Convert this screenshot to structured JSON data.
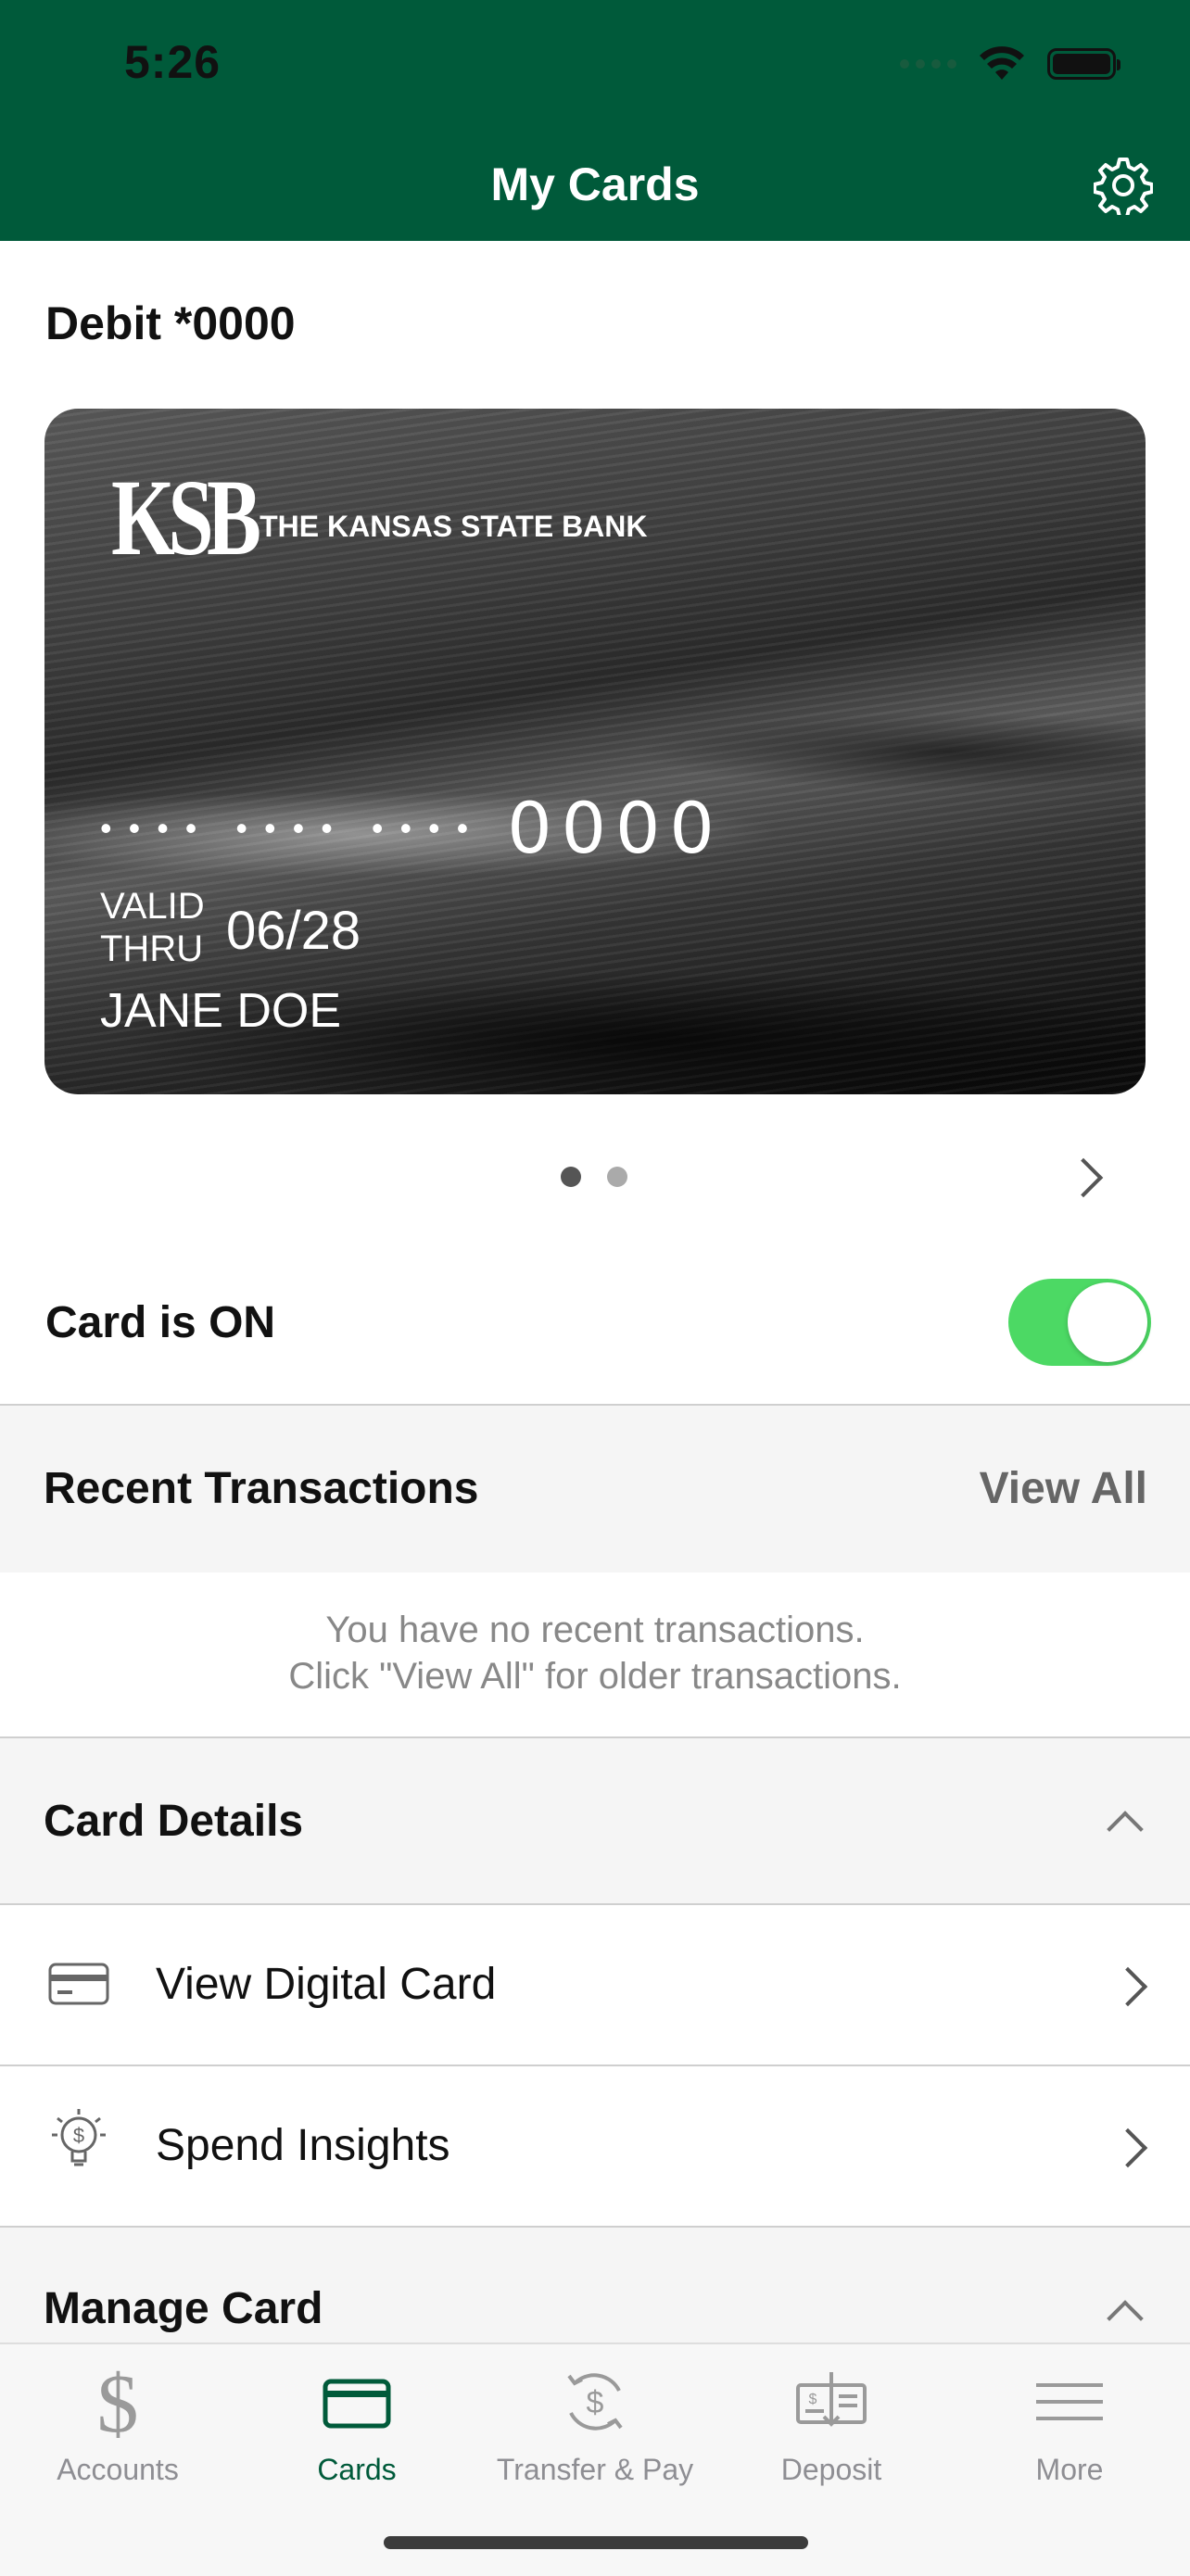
{
  "status_bar": {
    "time": "5:26"
  },
  "header": {
    "title": "My Cards",
    "settings_icon": "gear-icon",
    "background": "#005a3a"
  },
  "card": {
    "title": "Debit *0000",
    "bank_name": "THE KANSAS STATE BANK",
    "logo_mark": "KSB",
    "masked_groups": [
      "••••",
      "••••",
      "••••"
    ],
    "last4": "0000",
    "valid_label_1": "VALID",
    "valid_label_2": "THRU",
    "expiry": "06/28",
    "holder": "JANE DOE"
  },
  "pager": {
    "count": 2,
    "active_index": 0
  },
  "card_toggle": {
    "label": "Card is ON",
    "on": true,
    "color": "#4cd964"
  },
  "recent": {
    "title": "Recent Transactions",
    "view_all": "View All",
    "empty_line1": "You have no recent transactions.",
    "empty_line2": "Click \"View All\" for older transactions."
  },
  "card_details": {
    "title": "Card Details",
    "items": [
      {
        "label": "View Digital Card",
        "icon": "credit-card-icon"
      },
      {
        "label": "Spend Insights",
        "icon": "lightbulb-dollar-icon"
      }
    ]
  },
  "manage_card": {
    "title": "Manage Card"
  },
  "tabbar": {
    "active": "Cards",
    "accent": "#005a3a",
    "items": [
      {
        "label": "Accounts",
        "icon": "dollar-icon"
      },
      {
        "label": "Cards",
        "icon": "card-icon"
      },
      {
        "label": "Transfer & Pay",
        "icon": "transfer-icon"
      },
      {
        "label": "Deposit",
        "icon": "check-deposit-icon"
      },
      {
        "label": "More",
        "icon": "menu-icon"
      }
    ]
  }
}
